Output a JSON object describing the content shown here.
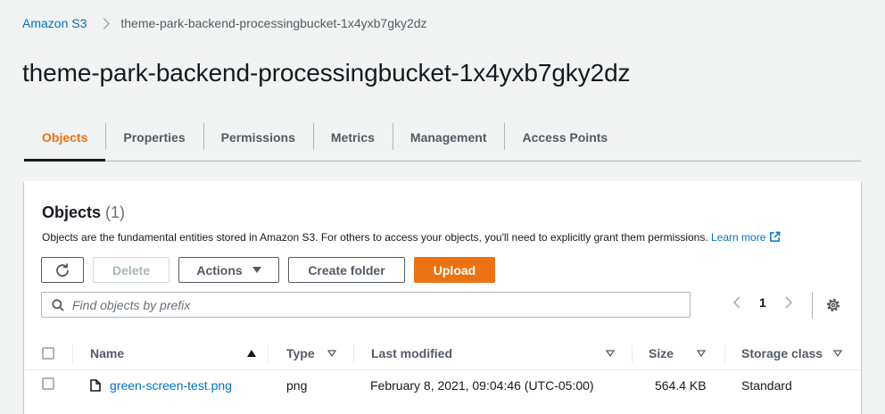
{
  "breadcrumb": {
    "root": "Amazon S3",
    "current": "theme-park-backend-processingbucket-1x4yxb7gky2dz"
  },
  "page_title": "theme-park-backend-processingbucket-1x4yxb7gky2dz",
  "tabs": [
    {
      "label": "Objects",
      "active": true
    },
    {
      "label": "Properties"
    },
    {
      "label": "Permissions"
    },
    {
      "label": "Metrics"
    },
    {
      "label": "Management"
    },
    {
      "label": "Access Points"
    }
  ],
  "objects_panel": {
    "title": "Objects",
    "count": "(1)",
    "description": "Objects are the fundamental entities stored in Amazon S3. For others to access your objects, you'll need to explicitly grant them permissions.",
    "learn_more": "Learn more",
    "buttons": {
      "delete": "Delete",
      "actions": "Actions",
      "create_folder": "Create folder",
      "upload": "Upload"
    },
    "search_placeholder": "Find objects by prefix",
    "current_page": "1"
  },
  "table": {
    "columns": [
      "Name",
      "Type",
      "Last modified",
      "Size",
      "Storage class"
    ],
    "rows": [
      {
        "name": "green-screen-test.png",
        "type": "png",
        "last_modified": "February 8, 2021, 09:04:46 (UTC-05:00)",
        "size": "564.4 KB",
        "storage_class": "Standard"
      }
    ]
  },
  "colors": {
    "accent": "#ec7211",
    "link": "#0073bb",
    "text": "#16191f",
    "muted": "#545b64"
  }
}
